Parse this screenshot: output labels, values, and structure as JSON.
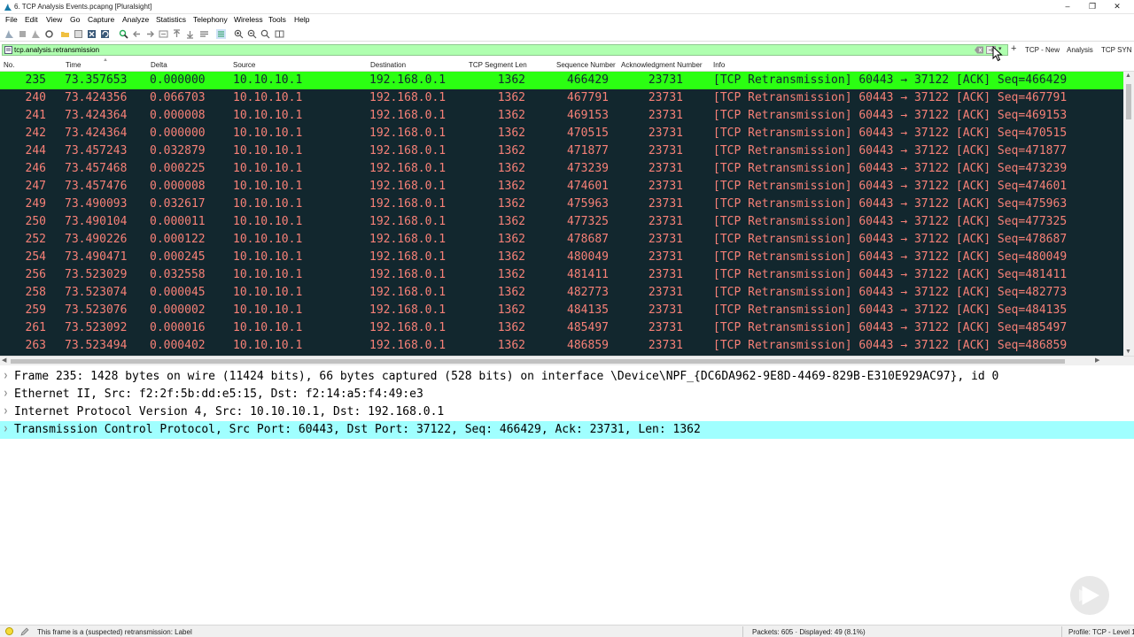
{
  "window": {
    "title": "6. TCP Analysis Events.pcapng [Pluralsight]",
    "app_icon": "wireshark-fin-icon",
    "controls": [
      "minimize-icon",
      "maximize-icon",
      "close-icon"
    ]
  },
  "menu": [
    "File",
    "Edit",
    "View",
    "Go",
    "Capture",
    "Analyze",
    "Statistics",
    "Telephony",
    "Wireless",
    "Tools",
    "Help"
  ],
  "toolbar": {
    "icons": [
      "start-capture-icon",
      "stop-capture-icon",
      "restart-capture-icon",
      "capture-options-icon",
      "open-file-icon",
      "save-file-icon",
      "close-file-icon",
      "reload-file-icon",
      "find-packet-icon",
      "go-back-icon",
      "go-forward-icon",
      "go-to-packet-icon",
      "first-packet-icon",
      "last-packet-icon",
      "autoscroll-icon",
      "colorize-icon",
      "zoom-in-icon",
      "zoom-out-icon",
      "normal-size-icon",
      "resize-columns-icon"
    ]
  },
  "filter": {
    "value": "tcp.analysis.retransmission",
    "buttons": [
      "TCP - New",
      "Analysis",
      "TCP SYN"
    ],
    "bg_color": "#afffaf"
  },
  "packet_list": {
    "columns": [
      "No.",
      "Time",
      "Delta",
      "Source",
      "Destination",
      "TCP Segment Len",
      "Sequence Number",
      "Acknowledgment Number",
      "Info"
    ],
    "colors": {
      "row_bg": "#12272e",
      "row_fg": "#f78077",
      "selected_bg": "#2bff12"
    },
    "rows": [
      {
        "no": "235",
        "time": "73.357653",
        "delta": "0.000000",
        "src": "10.10.10.1",
        "dst": "192.168.0.1",
        "len": "1362",
        "seq": "466429",
        "ack": "23731",
        "info": "[TCP Retransmission] 60443 → 37122 [ACK] Seq=466429"
      },
      {
        "no": "240",
        "time": "73.424356",
        "delta": "0.066703",
        "src": "10.10.10.1",
        "dst": "192.168.0.1",
        "len": "1362",
        "seq": "467791",
        "ack": "23731",
        "info": "[TCP Retransmission] 60443 → 37122 [ACK] Seq=467791"
      },
      {
        "no": "241",
        "time": "73.424364",
        "delta": "0.000008",
        "src": "10.10.10.1",
        "dst": "192.168.0.1",
        "len": "1362",
        "seq": "469153",
        "ack": "23731",
        "info": "[TCP Retransmission] 60443 → 37122 [ACK] Seq=469153"
      },
      {
        "no": "242",
        "time": "73.424364",
        "delta": "0.000000",
        "src": "10.10.10.1",
        "dst": "192.168.0.1",
        "len": "1362",
        "seq": "470515",
        "ack": "23731",
        "info": "[TCP Retransmission] 60443 → 37122 [ACK] Seq=470515"
      },
      {
        "no": "244",
        "time": "73.457243",
        "delta": "0.032879",
        "src": "10.10.10.1",
        "dst": "192.168.0.1",
        "len": "1362",
        "seq": "471877",
        "ack": "23731",
        "info": "[TCP Retransmission] 60443 → 37122 [ACK] Seq=471877"
      },
      {
        "no": "246",
        "time": "73.457468",
        "delta": "0.000225",
        "src": "10.10.10.1",
        "dst": "192.168.0.1",
        "len": "1362",
        "seq": "473239",
        "ack": "23731",
        "info": "[TCP Retransmission] 60443 → 37122 [ACK] Seq=473239"
      },
      {
        "no": "247",
        "time": "73.457476",
        "delta": "0.000008",
        "src": "10.10.10.1",
        "dst": "192.168.0.1",
        "len": "1362",
        "seq": "474601",
        "ack": "23731",
        "info": "[TCP Retransmission] 60443 → 37122 [ACK] Seq=474601"
      },
      {
        "no": "249",
        "time": "73.490093",
        "delta": "0.032617",
        "src": "10.10.10.1",
        "dst": "192.168.0.1",
        "len": "1362",
        "seq": "475963",
        "ack": "23731",
        "info": "[TCP Retransmission] 60443 → 37122 [ACK] Seq=475963"
      },
      {
        "no": "250",
        "time": "73.490104",
        "delta": "0.000011",
        "src": "10.10.10.1",
        "dst": "192.168.0.1",
        "len": "1362",
        "seq": "477325",
        "ack": "23731",
        "info": "[TCP Retransmission] 60443 → 37122 [ACK] Seq=477325"
      },
      {
        "no": "252",
        "time": "73.490226",
        "delta": "0.000122",
        "src": "10.10.10.1",
        "dst": "192.168.0.1",
        "len": "1362",
        "seq": "478687",
        "ack": "23731",
        "info": "[TCP Retransmission] 60443 → 37122 [ACK] Seq=478687"
      },
      {
        "no": "254",
        "time": "73.490471",
        "delta": "0.000245",
        "src": "10.10.10.1",
        "dst": "192.168.0.1",
        "len": "1362",
        "seq": "480049",
        "ack": "23731",
        "info": "[TCP Retransmission] 60443 → 37122 [ACK] Seq=480049"
      },
      {
        "no": "256",
        "time": "73.523029",
        "delta": "0.032558",
        "src": "10.10.10.1",
        "dst": "192.168.0.1",
        "len": "1362",
        "seq": "481411",
        "ack": "23731",
        "info": "[TCP Retransmission] 60443 → 37122 [ACK] Seq=481411"
      },
      {
        "no": "258",
        "time": "73.523074",
        "delta": "0.000045",
        "src": "10.10.10.1",
        "dst": "192.168.0.1",
        "len": "1362",
        "seq": "482773",
        "ack": "23731",
        "info": "[TCP Retransmission] 60443 → 37122 [ACK] Seq=482773"
      },
      {
        "no": "259",
        "time": "73.523076",
        "delta": "0.000002",
        "src": "10.10.10.1",
        "dst": "192.168.0.1",
        "len": "1362",
        "seq": "484135",
        "ack": "23731",
        "info": "[TCP Retransmission] 60443 → 37122 [ACK] Seq=484135"
      },
      {
        "no": "261",
        "time": "73.523092",
        "delta": "0.000016",
        "src": "10.10.10.1",
        "dst": "192.168.0.1",
        "len": "1362",
        "seq": "485497",
        "ack": "23731",
        "info": "[TCP Retransmission] 60443 → 37122 [ACK] Seq=485497"
      },
      {
        "no": "263",
        "time": "73.523494",
        "delta": "0.000402",
        "src": "10.10.10.1",
        "dst": "192.168.0.1",
        "len": "1362",
        "seq": "486859",
        "ack": "23731",
        "info": "[TCP Retransmission] 60443 → 37122 [ACK] Seq=486859"
      }
    ]
  },
  "details": {
    "highlight_color": "#a0ffff",
    "lines": [
      "Frame 235: 1428 bytes on wire (11424 bits), 66 bytes captured (528 bits) on interface \\Device\\NPF_{DC6DA962-9E8D-4469-829B-E310E929AC97}, id 0",
      "Ethernet II, Src: f2:2f:5b:dd:e5:15, Dst: f2:14:a5:f4:49:e3",
      "Internet Protocol Version 4, Src: 10.10.10.1, Dst: 192.168.0.1",
      "Transmission Control Protocol, Src Port: 60443, Dst Port: 37122, Seq: 466429, Ack: 23731, Len: 1362"
    ]
  },
  "status": {
    "message": "This frame is a (suspected) retransmission: Label",
    "packets": "Packets: 605 · Displayed: 49 (8.1%)",
    "profile": "Profile: TCP - Level 1"
  }
}
